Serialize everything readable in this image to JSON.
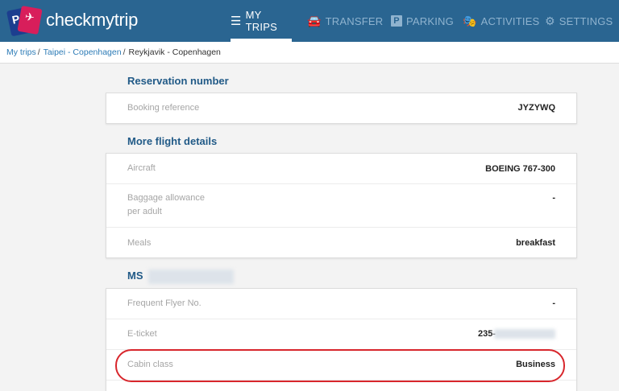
{
  "app": {
    "brand": "checkmytrip"
  },
  "nav": {
    "my_trips": "MY TRIPS",
    "transfer": "TRANSFER",
    "parking": "PARKING",
    "activities": "ACTIVITIES",
    "settings": "SETTINGS"
  },
  "breadcrumb": {
    "items": [
      "My trips",
      "Taipei - Copenhagen"
    ],
    "current": "Reykjavik - Copenhagen"
  },
  "reservation": {
    "title": "Reservation number",
    "booking_label": "Booking reference",
    "booking_value": "JYZYWQ"
  },
  "flight_details": {
    "title": "More flight details",
    "aircraft_label": "Aircraft",
    "aircraft_value": "BOEING 767-300",
    "baggage_label_1": "Baggage allowance",
    "baggage_label_2": "per adult",
    "baggage_value": "-",
    "meals_label": "Meals",
    "meals_value": "breakfast"
  },
  "passenger": {
    "title_prefix": "MS",
    "ff_label": "Frequent Flyer No.",
    "ff_value": "-",
    "eticket_label": "E-ticket",
    "eticket_value": "235-",
    "cabin_label": "Cabin class",
    "cabin_value": "Business"
  },
  "colors": {
    "header": "#2a6591",
    "title": "#215a87",
    "link": "#2c7bb6",
    "highlight": "#d8262c"
  }
}
